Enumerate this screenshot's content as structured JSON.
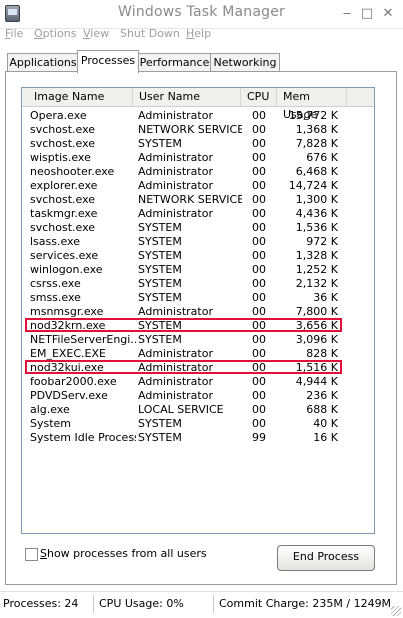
{
  "window": {
    "title": "Windows Task Manager"
  },
  "menu": [
    {
      "label": "File",
      "u": "F",
      "rest": "ile"
    },
    {
      "label": "Options",
      "u": "O",
      "rest": "ptions"
    },
    {
      "label": "View",
      "u": "V",
      "rest": "iew"
    },
    {
      "label": "Shut Down",
      "u": "",
      "rest": "Shut Down"
    },
    {
      "label": "Help",
      "u": "H",
      "rest": "elp"
    }
  ],
  "tabs": [
    "Applications",
    "Processes",
    "Performance",
    "Networking"
  ],
  "active_tab": "Processes",
  "columns": [
    "Image Name",
    "User Name",
    "CPU",
    "Mem Usage"
  ],
  "processes": [
    {
      "name": "Opera.exe",
      "user": "Administrator",
      "cpu": "00",
      "mem": "15,772 K"
    },
    {
      "name": "svchost.exe",
      "user": "NETWORK SERVICE",
      "cpu": "00",
      "mem": "1,368 K"
    },
    {
      "name": "svchost.exe",
      "user": "SYSTEM",
      "cpu": "00",
      "mem": "7,828 K"
    },
    {
      "name": "wisptis.exe",
      "user": "Administrator",
      "cpu": "00",
      "mem": "676 K"
    },
    {
      "name": "neoshooter.exe",
      "user": "Administrator",
      "cpu": "00",
      "mem": "6,468 K"
    },
    {
      "name": "explorer.exe",
      "user": "Administrator",
      "cpu": "00",
      "mem": "14,724 K"
    },
    {
      "name": "svchost.exe",
      "user": "NETWORK SERVICE",
      "cpu": "00",
      "mem": "1,300 K"
    },
    {
      "name": "taskmgr.exe",
      "user": "Administrator",
      "cpu": "00",
      "mem": "4,436 K"
    },
    {
      "name": "svchost.exe",
      "user": "SYSTEM",
      "cpu": "00",
      "mem": "1,536 K"
    },
    {
      "name": "lsass.exe",
      "user": "SYSTEM",
      "cpu": "00",
      "mem": "972 K"
    },
    {
      "name": "services.exe",
      "user": "SYSTEM",
      "cpu": "00",
      "mem": "1,328 K"
    },
    {
      "name": "winlogon.exe",
      "user": "SYSTEM",
      "cpu": "00",
      "mem": "1,252 K"
    },
    {
      "name": "csrss.exe",
      "user": "SYSTEM",
      "cpu": "00",
      "mem": "2,132 K"
    },
    {
      "name": "smss.exe",
      "user": "SYSTEM",
      "cpu": "00",
      "mem": "36 K"
    },
    {
      "name": "msnmsgr.exe",
      "user": "Administrator",
      "cpu": "00",
      "mem": "7,800 K"
    },
    {
      "name": "nod32krn.exe",
      "user": "SYSTEM",
      "cpu": "00",
      "mem": "3,656 K",
      "highlighted": true
    },
    {
      "name": "NETFileServerEngi...",
      "user": "SYSTEM",
      "cpu": "00",
      "mem": "3,096 K"
    },
    {
      "name": "EM_EXEC.EXE",
      "user": "Administrator",
      "cpu": "00",
      "mem": "828 K"
    },
    {
      "name": "nod32kui.exe",
      "user": "Administrator",
      "cpu": "00",
      "mem": "1,516 K",
      "highlighted": true
    },
    {
      "name": "foobar2000.exe",
      "user": "Administrator",
      "cpu": "00",
      "mem": "4,944 K"
    },
    {
      "name": "PDVDServ.exe",
      "user": "Administrator",
      "cpu": "00",
      "mem": "236 K"
    },
    {
      "name": "alg.exe",
      "user": "LOCAL SERVICE",
      "cpu": "00",
      "mem": "688 K"
    },
    {
      "name": "System",
      "user": "SYSTEM",
      "cpu": "00",
      "mem": "40 K"
    },
    {
      "name": "System Idle Process",
      "user": "SYSTEM",
      "cpu": "99",
      "mem": "16 K"
    }
  ],
  "show_all_label": "Show processes from all users",
  "end_process_label": "End Process",
  "status": {
    "processes": "Processes: 24",
    "cpu": "CPU Usage: 0%",
    "commit": "Commit Charge: 235M / 1249M"
  },
  "colors": {
    "highlight_box": "#e0103a",
    "list_border": "#7f9db9"
  }
}
